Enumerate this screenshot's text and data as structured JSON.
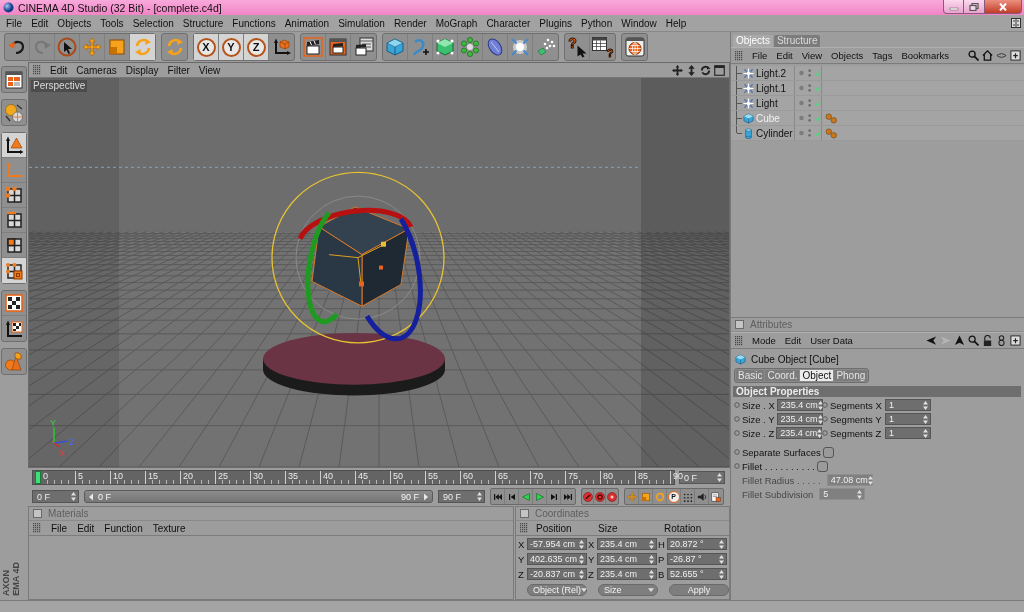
{
  "window": {
    "title": "CINEMA 4D Studio (32 Bit) - [complete.c4d]"
  },
  "menu_bar": [
    "File",
    "Edit",
    "Objects",
    "Tools",
    "Selection",
    "Structure",
    "Functions",
    "Animation",
    "Simulation",
    "Render",
    "MoGraph",
    "Character",
    "Plugins",
    "Python",
    "Window",
    "Help"
  ],
  "toolbar": [
    [
      {
        "kind": "undo",
        "on": false,
        "disabled": false
      },
      {
        "kind": "redo",
        "on": false,
        "disabled": true
      },
      {
        "kind": "live-selection",
        "on": false,
        "disabled": false
      },
      {
        "kind": "move",
        "on": false,
        "disabled": false
      },
      {
        "kind": "scale",
        "on": false,
        "disabled": false
      },
      {
        "kind": "rotate",
        "on": true,
        "disabled": false
      }
    ],
    [
      {
        "kind": "rotate",
        "on": false,
        "disabled": false
      }
    ],
    [
      {
        "kind": "axis",
        "label": "X",
        "on": true,
        "disabled": false
      },
      {
        "kind": "axis",
        "label": "Y",
        "on": true,
        "disabled": false
      },
      {
        "kind": "axis",
        "label": "Z",
        "on": true,
        "disabled": false
      },
      {
        "kind": "coordinate-system",
        "on": false,
        "disabled": false
      }
    ],
    [
      {
        "kind": "render-view",
        "on": false,
        "disabled": false
      },
      {
        "kind": "render-picture-viewer",
        "on": false,
        "disabled": false
      },
      {
        "kind": "render-settings",
        "on": false,
        "disabled": false
      }
    ],
    [
      {
        "kind": "cube",
        "on": false,
        "disabled": false
      },
      {
        "kind": "spline",
        "on": false,
        "disabled": false
      },
      {
        "kind": "subdivision",
        "on": false,
        "disabled": false
      },
      {
        "kind": "array",
        "on": false,
        "disabled": false
      },
      {
        "kind": "deformer",
        "on": false,
        "disabled": false
      },
      {
        "kind": "light",
        "on": false,
        "disabled": false
      },
      {
        "kind": "particles",
        "on": false,
        "disabled": false
      }
    ],
    [
      {
        "kind": "help",
        "label": "?",
        "on": false,
        "disabled": false
      },
      {
        "kind": "help-table",
        "label": "?",
        "on": false,
        "disabled": false
      }
    ],
    [
      {
        "kind": "browser",
        "on": false,
        "disabled": false
      }
    ]
  ],
  "mode_toolbar": [
    [
      {
        "kind": "layout",
        "on": false
      }
    ],
    [
      {
        "kind": "snap",
        "on": false
      }
    ],
    [
      {
        "kind": "model",
        "on": true
      },
      {
        "kind": "object-axis",
        "on": false
      },
      {
        "kind": "points",
        "on": false
      },
      {
        "kind": "edges",
        "on": false
      },
      {
        "kind": "polygons",
        "on": false
      },
      {
        "kind": "uv",
        "on": true
      }
    ],
    [
      {
        "kind": "texture",
        "on": false
      },
      {
        "kind": "texture-axis",
        "on": false
      }
    ],
    [
      {
        "kind": "workplane",
        "on": false
      }
    ]
  ],
  "brand_logo": [
    "AXON",
    "EMA 4D"
  ],
  "viewport": {
    "menu": [
      "Edit",
      "Cameras",
      "Display",
      "Filter",
      "View"
    ],
    "camera": "Perspective",
    "axis_labels": [
      "Y",
      "Z",
      "X"
    ]
  },
  "timeline": {
    "ticks": [
      "0",
      "5",
      "10",
      "15",
      "20",
      "25",
      "30",
      "35",
      "40",
      "45",
      "50",
      "55",
      "60",
      "65",
      "70",
      "75",
      "80",
      "85",
      "90"
    ],
    "playhead": {
      "level": 0
    },
    "current_frame": "0 F"
  },
  "transport": {
    "start_frame": "0 F",
    "range_start": "0 F",
    "range_end": "90 F",
    "range_fill": {
      "level": 1
    },
    "end_frame": "90 F",
    "parameter_key": "P"
  },
  "materials": {
    "title": "Materials",
    "menu": [
      "File",
      "Edit",
      "Function",
      "Texture"
    ]
  },
  "coordinates": {
    "title": "Coordinates",
    "columns": [
      "Position",
      "Size",
      "Rotation"
    ],
    "rows": [
      {
        "position_axis": "X",
        "position": "-57.954 cm",
        "size_axis": "X",
        "size": "235.4 cm",
        "rotation_axis": "H",
        "rotation": "20.872 °"
      },
      {
        "position_axis": "Y",
        "position": "402.635 cm",
        "size_axis": "Y",
        "size": "235.4 cm",
        "rotation_axis": "P",
        "rotation": "-26.87 °"
      },
      {
        "position_axis": "Z",
        "position": "-20.837 cm",
        "size_axis": "Z",
        "size": "235.4 cm",
        "rotation_axis": "B",
        "rotation": "52.655 °"
      }
    ],
    "position_mode": "Object (Rel)",
    "size_mode": "Size",
    "apply": "Apply"
  },
  "object_manager": {
    "tabs": [
      {
        "label": "Objects",
        "selected": true
      },
      {
        "label": "Structure",
        "selected": false
      }
    ],
    "menu": [
      "File",
      "Edit",
      "View",
      "Objects",
      "Tags",
      "Bookmarks"
    ],
    "objects": [
      {
        "name": "Light.2",
        "kind": "light",
        "selected": false,
        "enabled": true,
        "phong_tag": false
      },
      {
        "name": "Light.1",
        "kind": "light",
        "selected": false,
        "enabled": true,
        "phong_tag": false
      },
      {
        "name": "Light",
        "kind": "light",
        "selected": false,
        "enabled": true,
        "phong_tag": false
      },
      {
        "name": "Cube",
        "kind": "cube",
        "selected": true,
        "enabled": true,
        "phong_tag": true
      },
      {
        "name": "Cylinder",
        "kind": "cylinder",
        "selected": false,
        "enabled": true,
        "phong_tag": true
      }
    ]
  },
  "attributes": {
    "title": "Attributes",
    "menu": [
      "Mode",
      "Edit",
      "User Data"
    ],
    "object_title": "Cube Object [Cube]",
    "tabs": [
      {
        "label": "Basic",
        "selected": false
      },
      {
        "label": "Coord.",
        "selected": false
      },
      {
        "label": "Object",
        "selected": true
      },
      {
        "label": "Phong",
        "selected": false
      }
    ],
    "section": "Object Properties",
    "size_fields": [
      {
        "label": "Size . X",
        "value": "235.4 cm"
      },
      {
        "label": "Size . Y",
        "value": "235.4 cm"
      },
      {
        "label": "Size . Z",
        "value": "235.4 cm"
      }
    ],
    "segment_fields": [
      {
        "label": "Segments X",
        "value": "1"
      },
      {
        "label": "Segments Y",
        "value": "1"
      },
      {
        "label": "Segments Z",
        "value": "1"
      }
    ],
    "options": [
      {
        "kind": "checkbox",
        "label": "Separate Surfaces",
        "checked": false,
        "disabled": false
      },
      {
        "kind": "checkbox",
        "label": "Fillet . . . . . . . . . .",
        "checked": false,
        "disabled": false
      },
      {
        "kind": "number",
        "label": "Fillet Radius . . . . .",
        "value": "47.08 cm",
        "disabled": true
      },
      {
        "kind": "number",
        "label": "Fillet Subdivision",
        "value": "5",
        "disabled": true
      }
    ]
  }
}
